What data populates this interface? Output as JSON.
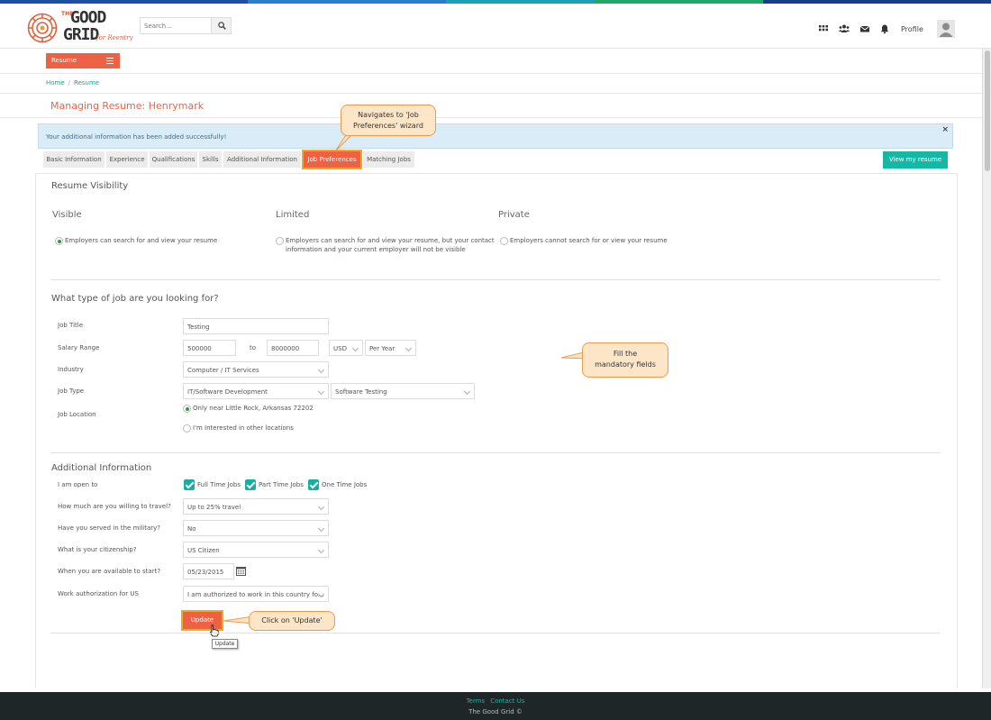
{
  "header": {
    "logo": {
      "line1": "THE",
      "line2": "GOOD",
      "line3": "GRID",
      "tagline": "for Reentry"
    },
    "search": {
      "placeholder": "Search..."
    },
    "icons": [
      "grid-icon",
      "users-icon",
      "mail-icon",
      "bell-icon"
    ],
    "profile_label": "Profile"
  },
  "resume_menu": {
    "label": "Resume"
  },
  "breadcrumb": {
    "home": "Home",
    "current": "Resume"
  },
  "page_title": "Managing Resume: Henrymark",
  "alert": {
    "message": "Your additional information has been added successfully!",
    "close": "×"
  },
  "tabs": [
    {
      "label": "Basic Information"
    },
    {
      "label": "Experience"
    },
    {
      "label": "Qualifications"
    },
    {
      "label": "Skills"
    },
    {
      "label": "Additional Information"
    },
    {
      "label": "Job Preferences",
      "active": true
    },
    {
      "label": "Matching Jobs"
    }
  ],
  "view_resume_button": "View my resume",
  "visibility": {
    "title": "Resume Visibility",
    "options": [
      {
        "title": "Visible",
        "text": "Employers can search for and view your resume",
        "selected": true
      },
      {
        "title": "Limited",
        "text_line1": "Employers can search for and view your resume, but your contact",
        "text_line2": "information and your current employer will not be visible",
        "selected": false
      },
      {
        "title": "Private",
        "text": "Employers cannot search for or view your resume",
        "selected": false
      }
    ]
  },
  "job_section": {
    "title": "What type of job are you looking for?",
    "job_title": {
      "label": "Job Title",
      "value": "Testing"
    },
    "salary": {
      "label": "Salary Range",
      "min": "500000",
      "to": "to",
      "max": "8000000",
      "currency": "USD",
      "period": "Per Year"
    },
    "industry": {
      "label": "Industry",
      "value": "Computer / IT Services"
    },
    "job_type": {
      "label": "Job Type",
      "value": "IT/Software Development",
      "sub_value": "Software Testing"
    },
    "location": {
      "label": "Job Location",
      "option1": "Only near Little Rock, Arkansas 72202",
      "option2": "I'm Interested in other locations"
    }
  },
  "additional": {
    "title": "Additional Information",
    "open_to": {
      "label": "I am open to",
      "options": [
        "Full Time Jobs",
        "Part Time Jobs",
        "One Time Jobs"
      ]
    },
    "travel": {
      "label": "How much are you willing to travel?",
      "value": "Up to 25% travel"
    },
    "military": {
      "label": "Have you served in the military?",
      "value": "No"
    },
    "citizenship": {
      "label": "What is your citizenship?",
      "value": "US Citizen"
    },
    "start": {
      "label": "When you are available to start?",
      "value": "05/23/2015"
    },
    "work_auth": {
      "label": "Work authorization for US",
      "value": "I am authorized to work in this country fo..."
    }
  },
  "update_button": "Update",
  "tooltip": "Update",
  "callouts": {
    "navigate": {
      "line1": "Navigates to 'Job",
      "line2": "Preferences' wizard"
    },
    "fill": {
      "line1": "Fill the",
      "line2": "mandatory fields"
    },
    "click": "Click on 'Update'"
  },
  "footer": {
    "terms": "Terms",
    "contact": "Contact Us",
    "copyright": "The Good Grid ©"
  },
  "colors": {
    "accent": "#ef6145",
    "teal": "#14b8a5",
    "footer_bg": "#1f2628"
  }
}
